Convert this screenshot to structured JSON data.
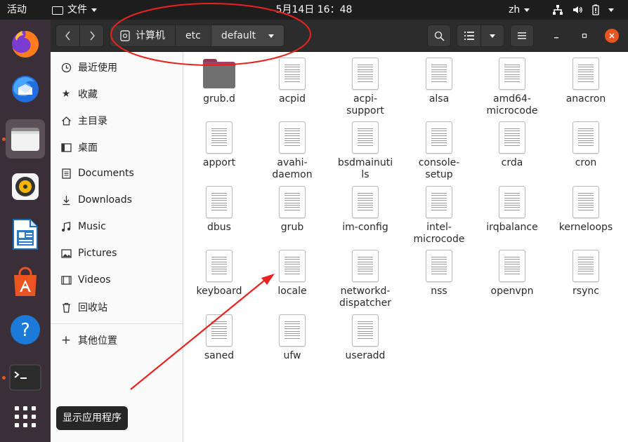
{
  "topbar": {
    "activities": "活动",
    "app_menu": "文件",
    "clock": "5月14日  16：48",
    "lang": "zh"
  },
  "dock": {
    "items": [
      {
        "name": "firefox-icon"
      },
      {
        "name": "thunderbird-icon"
      },
      {
        "name": "files-icon"
      },
      {
        "name": "rhythmbox-icon"
      },
      {
        "name": "libreoffice-writer-icon"
      },
      {
        "name": "software-center-icon"
      },
      {
        "name": "help-icon"
      },
      {
        "name": "terminal-icon"
      },
      {
        "name": "show-apps-icon"
      }
    ],
    "tooltip": "显示应用程序"
  },
  "headerbar": {
    "breadcrumbs": [
      "计算机",
      "etc",
      "default"
    ]
  },
  "sidebar": {
    "items": [
      {
        "label": "最近使用",
        "icon": "clock-icon"
      },
      {
        "label": "收藏",
        "icon": "star-icon"
      },
      {
        "label": "主目录",
        "icon": "home-icon"
      },
      {
        "label": "桌面",
        "icon": "desktop-icon"
      },
      {
        "label": "Documents",
        "icon": "document-icon"
      },
      {
        "label": "Downloads",
        "icon": "download-icon"
      },
      {
        "label": "Music",
        "icon": "music-icon"
      },
      {
        "label": "Pictures",
        "icon": "picture-icon"
      },
      {
        "label": "Videos",
        "icon": "video-icon"
      },
      {
        "label": "回收站",
        "icon": "trash-icon"
      }
    ],
    "other": {
      "label": "其他位置",
      "icon": "plus-icon"
    }
  },
  "files": [
    {
      "name": "grub.d",
      "type": "folder"
    },
    {
      "name": "acpid",
      "type": "file"
    },
    {
      "name": "acpi-\nsupport",
      "type": "file"
    },
    {
      "name": "alsa",
      "type": "file"
    },
    {
      "name": "amd64-\nmicrocode",
      "type": "file"
    },
    {
      "name": "anacron",
      "type": "file"
    },
    {
      "name": "apport",
      "type": "file"
    },
    {
      "name": "avahi-\ndaemon",
      "type": "file"
    },
    {
      "name": "bsdmainuti\nls",
      "type": "file"
    },
    {
      "name": "console-\nsetup",
      "type": "file"
    },
    {
      "name": "crda",
      "type": "file"
    },
    {
      "name": "cron",
      "type": "file"
    },
    {
      "name": "dbus",
      "type": "file"
    },
    {
      "name": "grub",
      "type": "file"
    },
    {
      "name": "im-config",
      "type": "file"
    },
    {
      "name": "intel-\nmicrocode",
      "type": "file"
    },
    {
      "name": "irqbalance",
      "type": "file"
    },
    {
      "name": "kerneloops",
      "type": "file"
    },
    {
      "name": "keyboard",
      "type": "file"
    },
    {
      "name": "locale",
      "type": "file"
    },
    {
      "name": "networkd-\ndispatcher",
      "type": "file"
    },
    {
      "name": "nss",
      "type": "file"
    },
    {
      "name": "openvpn",
      "type": "file"
    },
    {
      "name": "rsync",
      "type": "file"
    },
    {
      "name": "saned",
      "type": "file"
    },
    {
      "name": "ufw",
      "type": "file"
    },
    {
      "name": "useradd",
      "type": "file"
    }
  ],
  "colors": {
    "accent": "#e95420",
    "annotation": "#e8231f"
  }
}
